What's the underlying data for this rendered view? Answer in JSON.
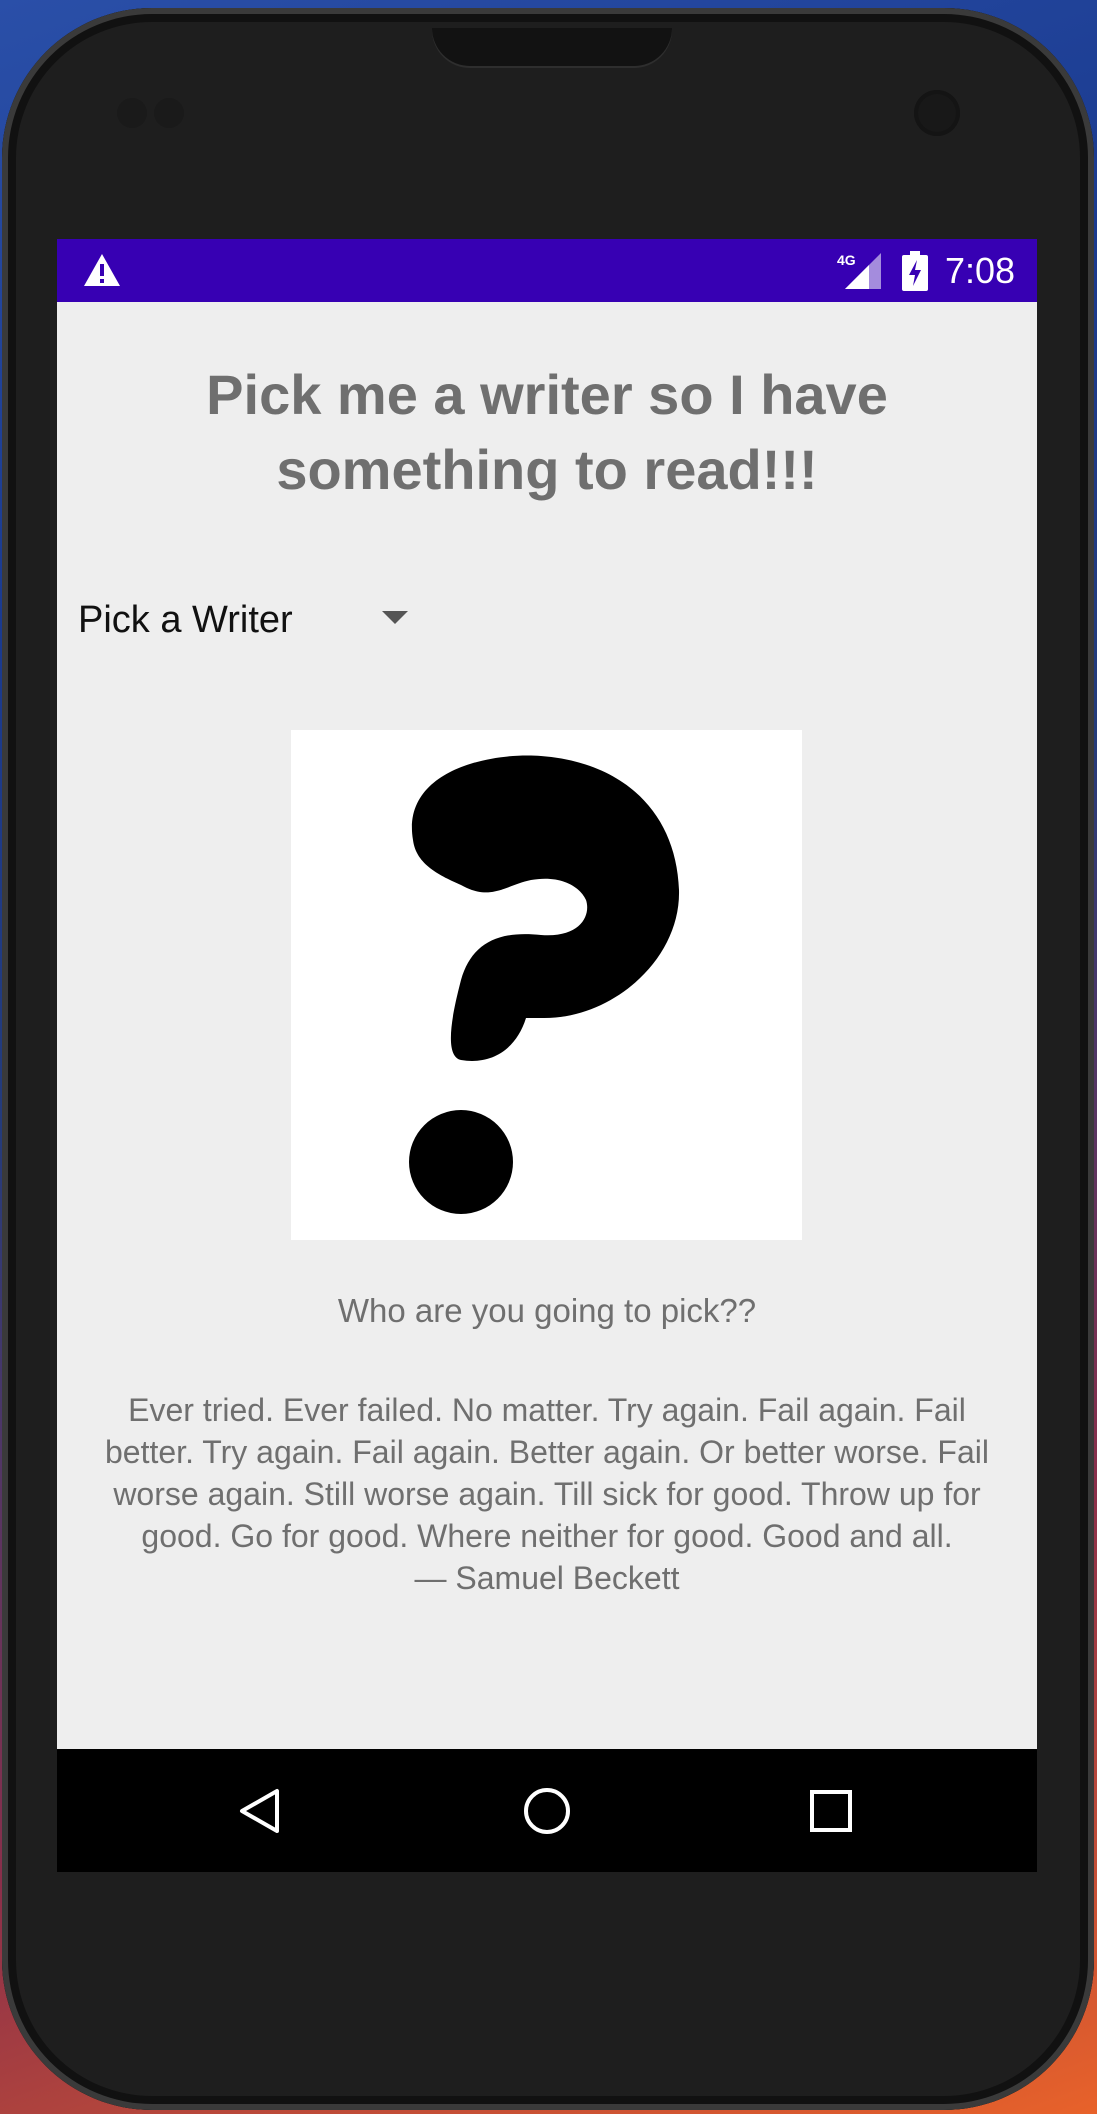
{
  "status_bar": {
    "time": "7:08",
    "network": "4G",
    "icons": [
      "warning-icon",
      "signal-icon",
      "battery-charging-icon"
    ],
    "background": "#3700b3"
  },
  "main": {
    "title_line1": "Pick me a writer so I have",
    "title_line2": "something to read!!!",
    "spinner": {
      "selected": "Pick a Writer"
    },
    "image_icon": "question-mark-icon",
    "caption": "Who are you going to pick??",
    "quote": {
      "lines": [
        "Ever tried. Ever failed. No matter. Try again. Fail again. Fail",
        "better. Try again. Fail again. Better again. Or better worse. Fail",
        "worse again. Still worse again. Till sick for good. Throw up for",
        "good. Go for good. Where neither for good. Good and all."
      ],
      "author": "— Samuel Beckett"
    }
  },
  "nav_bar": {
    "icons": [
      "back-icon",
      "home-icon",
      "recents-icon"
    ]
  },
  "colors": {
    "text_gray": "#6f6f6f",
    "screen_bg": "#eeeeee",
    "status_bar": "#3700b3"
  }
}
